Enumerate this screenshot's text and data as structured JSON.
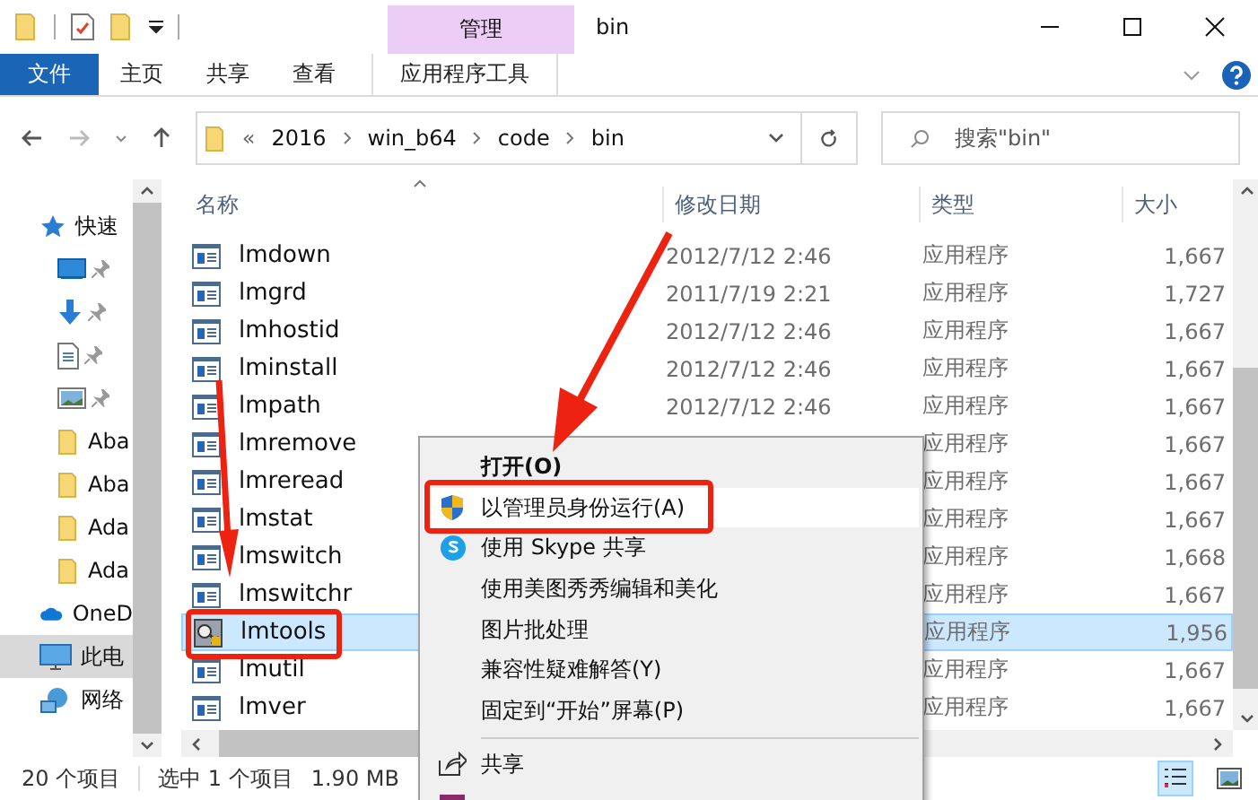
{
  "title_bar": {
    "contextual_tab": "管理",
    "title": "bin"
  },
  "ribbon_tabs": [
    {
      "label": "文件",
      "kind": "file"
    },
    {
      "label": "主页",
      "kind": "normal"
    },
    {
      "label": "共享",
      "kind": "normal"
    },
    {
      "label": "查看",
      "kind": "normal"
    },
    {
      "label": "应用程序工具",
      "kind": "contextual"
    }
  ],
  "address_bar": {
    "overflow": "«",
    "segments": [
      "2016",
      "win_b64",
      "code",
      "bin"
    ]
  },
  "search": {
    "placeholder": "搜索\"bin\""
  },
  "sidebar": {
    "items": [
      {
        "label": "快速",
        "kind": "star",
        "pinned": false,
        "selected": false
      },
      {
        "kind": "desktop",
        "pinned": true,
        "selected": false
      },
      {
        "kind": "download",
        "pinned": true,
        "selected": false
      },
      {
        "kind": "document",
        "pinned": true,
        "selected": false
      },
      {
        "kind": "picture",
        "pinned": true,
        "selected": false
      },
      {
        "label": "Aba",
        "kind": "folder",
        "pinned": false,
        "selected": false
      },
      {
        "label": "Aba",
        "kind": "folder",
        "pinned": false,
        "selected": false
      },
      {
        "label": "Ada",
        "kind": "folder",
        "pinned": false,
        "selected": false
      },
      {
        "label": "Ada",
        "kind": "folder",
        "pinned": false,
        "selected": false
      },
      {
        "label": "OneD",
        "kind": "cloud",
        "pinned": false,
        "selected": false
      },
      {
        "label": "此电",
        "kind": "pc",
        "pinned": false,
        "selected": true
      },
      {
        "label": "网络",
        "kind": "network",
        "pinned": false,
        "selected": false
      }
    ]
  },
  "table": {
    "columns": [
      "名称",
      "修改日期",
      "类型",
      "大小"
    ],
    "rows": [
      {
        "name": "lmdown",
        "date": "2012/7/12 2:46",
        "type": "应用程序",
        "size": "1,667",
        "kind": "app",
        "selected": false
      },
      {
        "name": "lmgrd",
        "date": "2011/7/19 2:21",
        "type": "应用程序",
        "size": "1,727",
        "kind": "app",
        "selected": false
      },
      {
        "name": "lmhostid",
        "date": "2012/7/12 2:46",
        "type": "应用程序",
        "size": "1,667",
        "kind": "app",
        "selected": false
      },
      {
        "name": "lminstall",
        "date": "2012/7/12 2:46",
        "type": "应用程序",
        "size": "1,667",
        "kind": "app",
        "selected": false
      },
      {
        "name": "lmpath",
        "date": "2012/7/12 2:46",
        "type": "应用程序",
        "size": "1,667",
        "kind": "app",
        "selected": false
      },
      {
        "name": "lmremove",
        "type": "应用程序",
        "size": "1,667",
        "kind": "app",
        "selected": false
      },
      {
        "name": "lmreread",
        "type": "应用程序",
        "size": "1,667",
        "kind": "app",
        "selected": false
      },
      {
        "name": "lmstat",
        "type": "应用程序",
        "size": "1,667",
        "kind": "app",
        "selected": false
      },
      {
        "name": "lmswitch",
        "type": "应用程序",
        "size": "1,668",
        "kind": "app",
        "selected": false
      },
      {
        "name": "lmswitchr",
        "type": "应用程序",
        "size": "1,667",
        "kind": "app",
        "selected": false
      },
      {
        "name": "lmtools",
        "type": "应用程序",
        "size": "1,956",
        "kind": "tool",
        "selected": true
      },
      {
        "name": "lmutil",
        "type": "应用程序",
        "size": "1,667",
        "kind": "app",
        "selected": false
      },
      {
        "name": "lmver",
        "type": "应用程序",
        "size": "1,667",
        "kind": "app",
        "selected": false
      }
    ]
  },
  "context_menu": {
    "items": [
      {
        "label": "打开(O)",
        "kind": "default",
        "highlighted": false
      },
      {
        "label": "以管理员身份运行(A)",
        "kind": "shield",
        "highlighted": true
      },
      {
        "label": "使用 Skype 共享",
        "kind": "skype",
        "highlighted": false
      },
      {
        "label": "使用美图秀秀编辑和美化",
        "kind": "plain",
        "highlighted": false
      },
      {
        "label": "图片批处理",
        "kind": "plain",
        "highlighted": false
      },
      {
        "label": "兼容性疑难解答(Y)",
        "kind": "plain",
        "highlighted": false
      },
      {
        "label": "固定到“开始”屏幕(P)",
        "kind": "plain",
        "highlighted": false
      },
      {
        "kind": "separator"
      },
      {
        "label": "共享",
        "kind": "share",
        "highlighted": false
      },
      {
        "kind": "archive",
        "highlighted": false
      }
    ]
  },
  "status_bar": {
    "count": "20 个项目",
    "selection": "选中 1 个项目",
    "size": "1.90 MB"
  }
}
